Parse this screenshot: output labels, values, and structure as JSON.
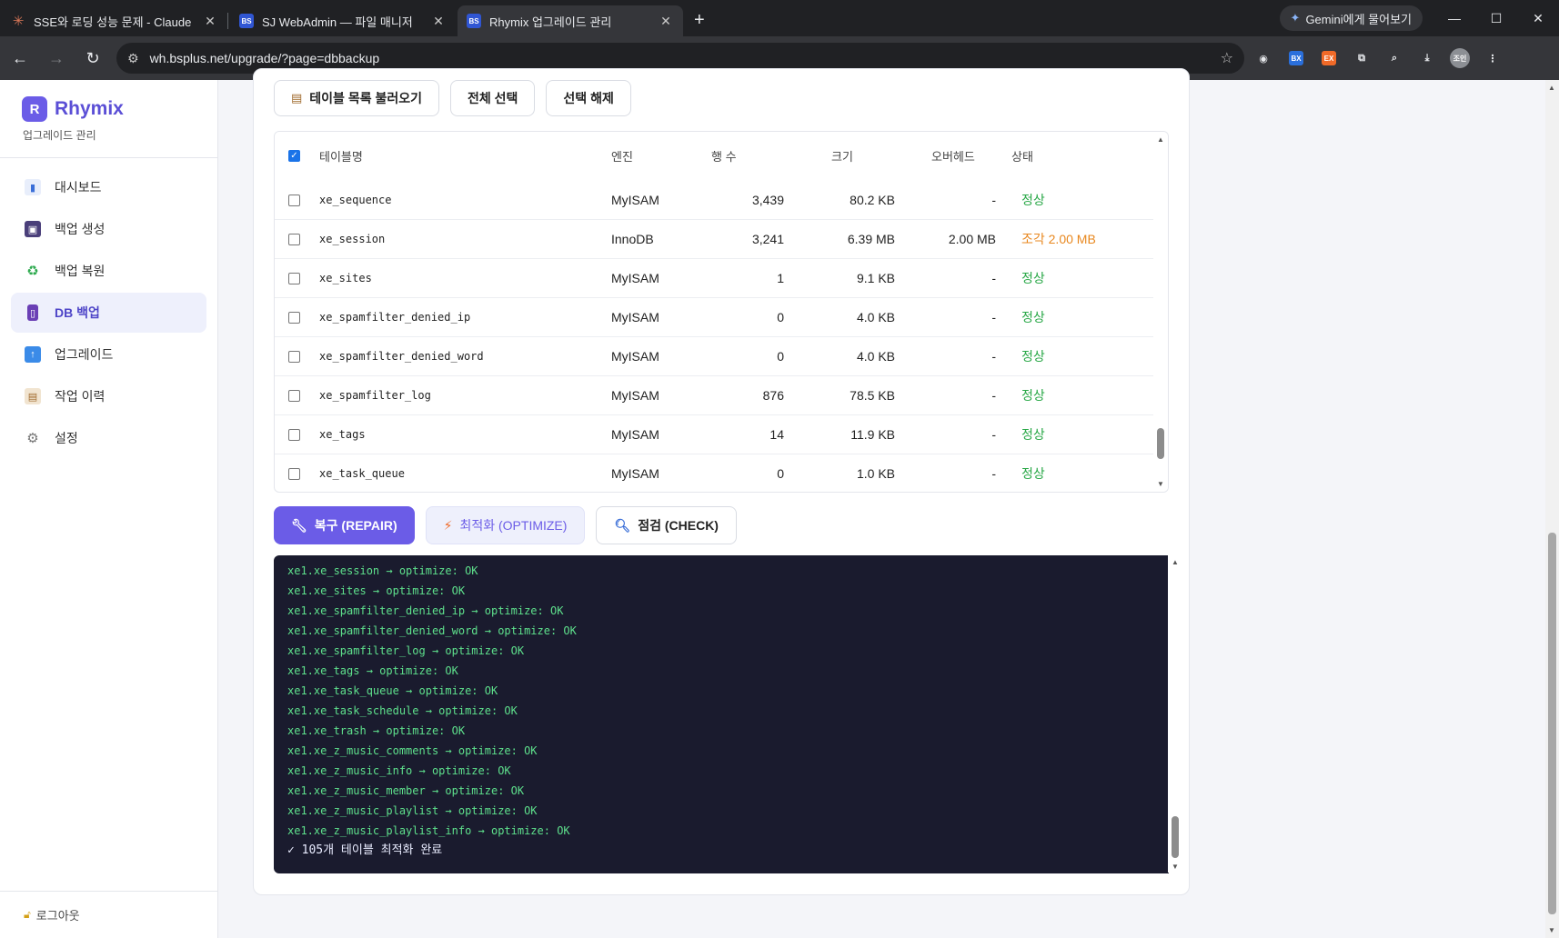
{
  "browser": {
    "tabs": [
      {
        "title": "SSE와 로딩 성능 문제 - Claude",
        "favicon": "claude-icon",
        "color": "#d97757"
      },
      {
        "title": "SJ WebAdmin — 파일 매니저",
        "favicon": "bs-icon",
        "color": "#3056d3"
      },
      {
        "title": "Rhymix 업그레이드 관리",
        "favicon": "bs-icon",
        "color": "#3056d3"
      }
    ],
    "gemini_label": "Gemini에게 물어보기",
    "url": "wh.bsplus.net/upgrade/?page=dbbackup",
    "profile_label": "조인"
  },
  "brand": {
    "logo_letter": "R",
    "name": "Rhymix",
    "subtitle": "업그레이드 관리",
    "accent": "#6b5ce7"
  },
  "menu": [
    {
      "label": "대시보드",
      "icon": "chart-icon"
    },
    {
      "label": "백업 생성",
      "icon": "floppy-icon"
    },
    {
      "label": "백업 복원",
      "icon": "recycle-icon"
    },
    {
      "label": "DB 백업",
      "icon": "database-icon",
      "active": true
    },
    {
      "label": "업그레이드",
      "icon": "upgrade-icon"
    },
    {
      "label": "작업 이력",
      "icon": "clipboard-icon"
    },
    {
      "label": "설정",
      "icon": "gear-icon"
    }
  ],
  "logout_label": "로그아웃",
  "toolbar": {
    "load_tables": "테이블 목록 불러오기",
    "select_all": "전체 선택",
    "deselect": "선택 해제"
  },
  "table": {
    "headers": {
      "name": "테이블명",
      "engine": "엔진",
      "rows": "행 수",
      "size": "크기",
      "overhead": "오버헤드",
      "status": "상태"
    },
    "rows": [
      {
        "name": "xe_sequence",
        "engine": "MyISAM",
        "rows": "3,439",
        "size": "80.2 KB",
        "overhead": "-",
        "status": "정상",
        "warn": false
      },
      {
        "name": "xe_session",
        "engine": "InnoDB",
        "rows": "3,241",
        "size": "6.39 MB",
        "overhead": "2.00 MB",
        "status": "조각 2.00 MB",
        "warn": true
      },
      {
        "name": "xe_sites",
        "engine": "MyISAM",
        "rows": "1",
        "size": "9.1 KB",
        "overhead": "-",
        "status": "정상",
        "warn": false
      },
      {
        "name": "xe_spamfilter_denied_ip",
        "engine": "MyISAM",
        "rows": "0",
        "size": "4.0 KB",
        "overhead": "-",
        "status": "정상",
        "warn": false
      },
      {
        "name": "xe_spamfilter_denied_word",
        "engine": "MyISAM",
        "rows": "0",
        "size": "4.0 KB",
        "overhead": "-",
        "status": "정상",
        "warn": false
      },
      {
        "name": "xe_spamfilter_log",
        "engine": "MyISAM",
        "rows": "876",
        "size": "78.5 KB",
        "overhead": "-",
        "status": "정상",
        "warn": false
      },
      {
        "name": "xe_tags",
        "engine": "MyISAM",
        "rows": "14",
        "size": "11.9 KB",
        "overhead": "-",
        "status": "정상",
        "warn": false
      },
      {
        "name": "xe_task_queue",
        "engine": "MyISAM",
        "rows": "0",
        "size": "1.0 KB",
        "overhead": "-",
        "status": "정상",
        "warn": false
      }
    ]
  },
  "actions": {
    "repair": "복구 (REPAIR)",
    "optimize": "최적화 (OPTIMIZE)",
    "check": "점검 (CHECK)"
  },
  "console": {
    "lines": [
      "xe1.xe_session → optimize: OK",
      "xe1.xe_sites → optimize: OK",
      "xe1.xe_spamfilter_denied_ip → optimize: OK",
      "xe1.xe_spamfilter_denied_word → optimize: OK",
      "xe1.xe_spamfilter_log → optimize: OK",
      "xe1.xe_tags → optimize: OK",
      "xe1.xe_task_queue → optimize: OK",
      "xe1.xe_task_schedule → optimize: OK",
      "xe1.xe_trash → optimize: OK",
      "xe1.xe_z_music_comments → optimize: OK",
      "xe1.xe_z_music_info → optimize: OK",
      "xe1.xe_z_music_member → optimize: OK",
      "xe1.xe_z_music_playlist → optimize: OK",
      "xe1.xe_z_music_playlist_info → optimize: OK"
    ],
    "summary": "✓ 105개 테이블 최적화 완료"
  }
}
